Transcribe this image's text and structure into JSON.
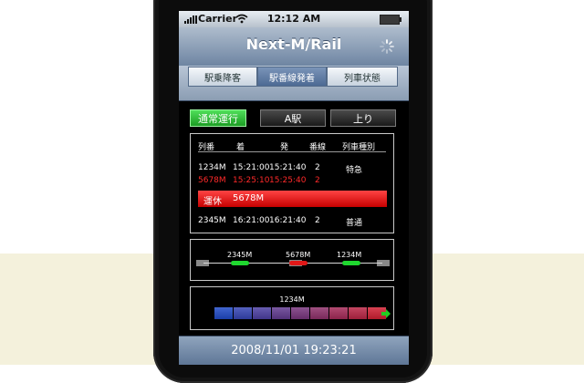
{
  "status_bar": {
    "carrier": "Carrier",
    "time": "12:12 AM"
  },
  "nav": {
    "title": "Next-M/Rail"
  },
  "tabs": [
    {
      "label": "駅乗降客",
      "selected": false
    },
    {
      "label": "駅番線発着",
      "selected": true
    },
    {
      "label": "列車状態",
      "selected": false
    }
  ],
  "controls": {
    "mode": "通常運行",
    "station": "A駅",
    "direction": "上り"
  },
  "timetable": {
    "headers": [
      "列番",
      "着",
      "発",
      "番線",
      "列車種別"
    ],
    "rows": [
      {
        "train": "1234M",
        "arr": "15:21:00",
        "dep": "15:21:40",
        "track": "2",
        "type": "特急",
        "highlight": false
      },
      {
        "train": "5678M",
        "arr": "15:25:10",
        "dep": "15:25:40",
        "track": "2",
        "type": "",
        "highlight": true
      },
      {
        "train": "2345M",
        "arr": "16:21:00",
        "dep": "16:21:40",
        "track": "2",
        "type": "普通",
        "highlight": false
      }
    ],
    "suspended": {
      "label": "運休",
      "train": "5678M"
    }
  },
  "track_view": {
    "trains": [
      {
        "label": "2345M",
        "color": "#1fd82f"
      },
      {
        "label": "5678M",
        "color": "#e01818"
      },
      {
        "label": "1234M",
        "color": "#1fd82f"
      }
    ]
  },
  "position_view": {
    "train": "1234M",
    "gradient_from": "#1a3ea8",
    "gradient_to": "#b01a2a",
    "arrow_color": "#22cc22"
  },
  "footer": {
    "datetime": "2008/11/01 19:23:21"
  },
  "colors": {
    "nav_blue": "#6e85a2",
    "active_green": "#1c9d24",
    "alert_red": "#d40000"
  }
}
